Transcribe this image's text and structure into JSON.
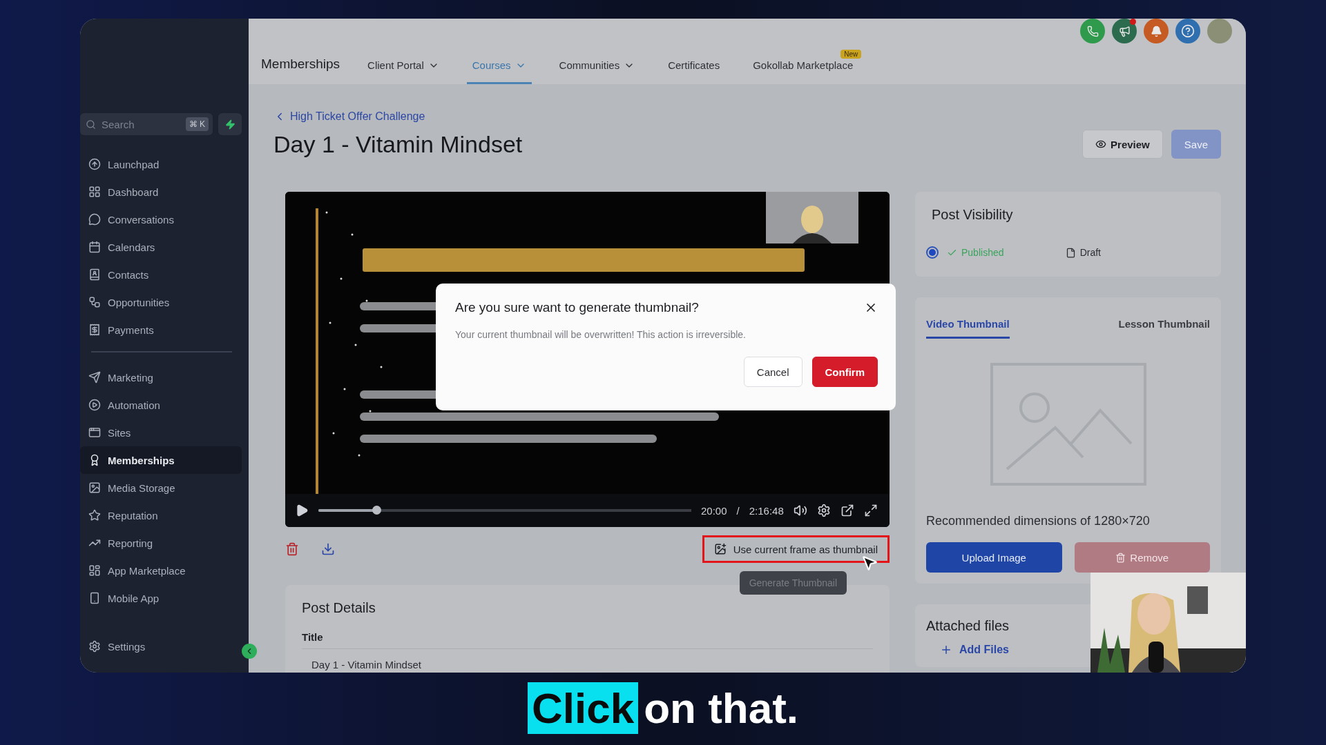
{
  "sidebar": {
    "search": {
      "placeholder": "Search",
      "shortcut": "⌘ K"
    },
    "groups": [
      [
        {
          "label": "Launchpad",
          "selected": false
        },
        {
          "label": "Dashboard",
          "selected": false
        },
        {
          "label": "Conversations",
          "selected": false
        },
        {
          "label": "Calendars",
          "selected": false
        },
        {
          "label": "Contacts",
          "selected": false
        },
        {
          "label": "Opportunities",
          "selected": false
        },
        {
          "label": "Payments",
          "selected": false
        }
      ],
      [
        {
          "label": "Marketing",
          "selected": false
        },
        {
          "label": "Automation",
          "selected": false
        },
        {
          "label": "Sites",
          "selected": false
        },
        {
          "label": "Memberships",
          "selected": true
        },
        {
          "label": "Media Storage",
          "selected": false
        },
        {
          "label": "Reputation",
          "selected": false
        },
        {
          "label": "Reporting",
          "selected": false
        },
        {
          "label": "App Marketplace",
          "selected": false
        },
        {
          "label": "Mobile App",
          "selected": false
        }
      ]
    ],
    "settings": "Settings"
  },
  "nav": {
    "title": "Memberships",
    "tabs": [
      {
        "label": "Client Portal",
        "selected": false,
        "dropdown": true
      },
      {
        "label": "Courses",
        "selected": true,
        "dropdown": true
      },
      {
        "label": "Communities",
        "selected": false,
        "dropdown": true
      },
      {
        "label": "Certificates",
        "selected": false,
        "dropdown": false
      },
      {
        "label": "Gokollab Marketplace",
        "selected": false,
        "dropdown": false,
        "badge": "New"
      }
    ]
  },
  "breadcrumb": "High Ticket Offer Challenge",
  "page_title": "Day 1 - Vitamin Mindset",
  "actions": [
    {
      "label": "Preview",
      "kind": "preview",
      "disabled": false
    },
    {
      "label": "Save",
      "kind": "save",
      "disabled": true
    }
  ],
  "player": {
    "time": "20:00",
    "separator": "/",
    "duration": "2:16:48",
    "level": 0.157
  },
  "thumbnail_action": {
    "label": "Use current frame as thumbnail",
    "highlighted": true,
    "tooltip": "Generate Thumbnail"
  },
  "post_details": {
    "title": "Post Details",
    "field_label": "Title",
    "value": "Day 1 - Vitamin Mindset"
  },
  "visibility": {
    "title": "Post Visibility",
    "options": [
      {
        "label": "Published",
        "selected": true
      },
      {
        "label": "Draft",
        "selected": false
      }
    ]
  },
  "thumbnail": {
    "tabs": [
      {
        "label": "Video Thumbnail",
        "selected": true
      },
      {
        "label": "Lesson Thumbnail",
        "selected": false
      }
    ],
    "hint": "Recommended dimensions of 1280×720",
    "buttons": [
      {
        "label": "Upload Image",
        "kind": "upload",
        "disabled": false
      },
      {
        "label": "Remove",
        "kind": "remove",
        "disabled": true
      }
    ]
  },
  "attachments": {
    "title": "Attached files",
    "add": "Add Files"
  },
  "dialog": {
    "title": "Are you sure want to generate thumbnail?",
    "message": "Your current thumbnail will be overwritten! This action is irreversible.",
    "buttons": [
      {
        "label": "Cancel",
        "kind": "secondary"
      },
      {
        "label": "Confirm",
        "kind": "primary"
      }
    ]
  },
  "caption": {
    "highlight": "Click",
    "text": "on that."
  }
}
